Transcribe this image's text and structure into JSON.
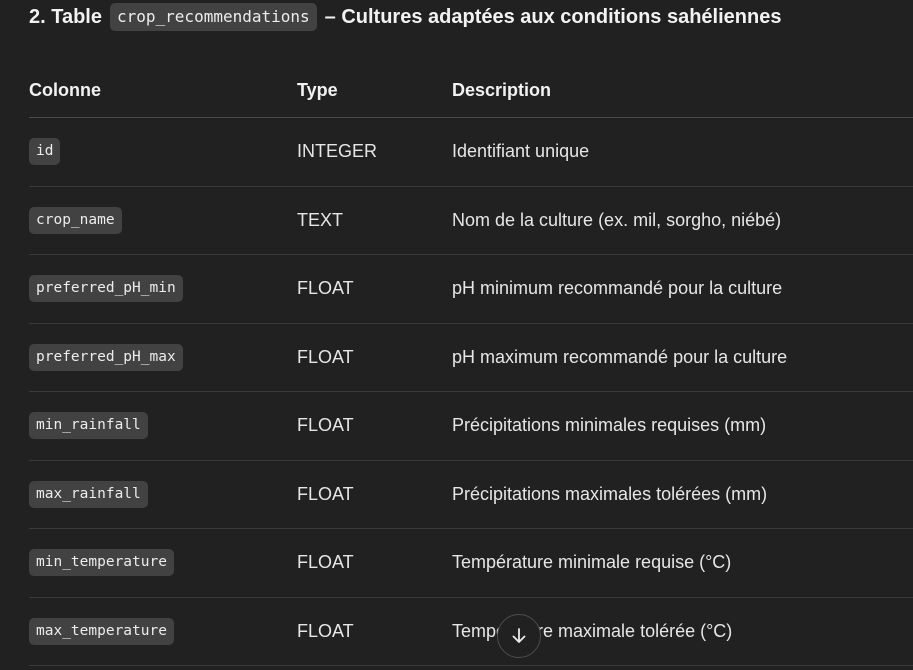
{
  "heading": {
    "prefix": "2. Table",
    "table_name": "crop_recommendations",
    "suffix": "– Cultures adaptées aux conditions sahéliennes"
  },
  "table": {
    "headers": [
      "Colonne",
      "Type",
      "Description"
    ],
    "rows": [
      {
        "column": "id",
        "type": "INTEGER",
        "description": "Identifiant unique"
      },
      {
        "column": "crop_name",
        "type": "TEXT",
        "description": "Nom de la culture (ex. mil, sorgho, niébé)"
      },
      {
        "column": "preferred_pH_min",
        "type": "FLOAT",
        "description": "pH minimum recommandé pour la culture"
      },
      {
        "column": "preferred_pH_max",
        "type": "FLOAT",
        "description": "pH maximum recommandé pour la culture"
      },
      {
        "column": "min_rainfall",
        "type": "FLOAT",
        "description": "Précipitations minimales requises (mm)"
      },
      {
        "column": "max_rainfall",
        "type": "FLOAT",
        "description": "Précipitations maximales tolérées (mm)"
      },
      {
        "column": "min_temperature",
        "type": "FLOAT",
        "description": "Température minimale requise (°C)"
      },
      {
        "column": "max_temperature",
        "type": "FLOAT",
        "description": "Température maximale tolérée (°C)"
      }
    ]
  },
  "scroll_button": {
    "icon": "arrow-down-icon"
  },
  "colors": {
    "background": "#212121",
    "code_chip": "#424242",
    "text": "#ececec",
    "divider": "#3a3a3a"
  }
}
